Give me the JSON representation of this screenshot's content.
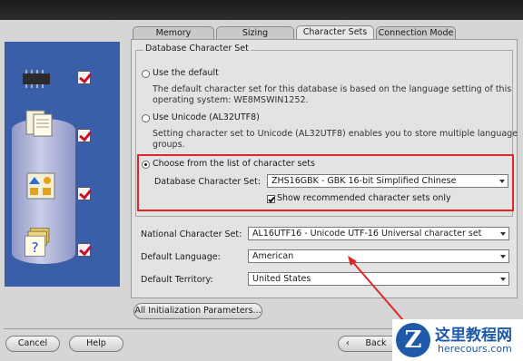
{
  "tabs": [
    {
      "label": "Memory"
    },
    {
      "label": "Sizing"
    },
    {
      "label": "Character Sets",
      "active": true
    },
    {
      "label": "Connection Mode"
    }
  ],
  "group_title": "Database Character Set",
  "options": {
    "default": {
      "label": "Use the default",
      "desc_line1": "The default character set for this database is based on the language setting of this",
      "desc_line2": "operating system: WE8MSWIN1252."
    },
    "unicode": {
      "label": "Use Unicode (AL32UTF8)",
      "desc_line1": "Setting character set to Unicode (AL32UTF8) enables you to store multiple language",
      "desc_line2": "groups."
    },
    "choose": {
      "label": "Choose from the list of character sets",
      "selected": true
    }
  },
  "db_charset": {
    "label": "Database Character Set:",
    "value": "ZHS16GBK - GBK 16-bit Simplified Chinese"
  },
  "show_recommended": {
    "label": "Show recommended character sets only",
    "checked": true
  },
  "national_charset": {
    "label": "National Character Set:",
    "value": "AL16UTF16 - Unicode UTF-16 Universal character set"
  },
  "default_language": {
    "label": "Default Language:",
    "value": "American"
  },
  "default_territory": {
    "label": "Default Territory:",
    "value": "United States"
  },
  "buttons": {
    "init_params": "All Initialization Parameters...",
    "cancel": "Cancel",
    "help": "Help",
    "back": "Back"
  },
  "watermark": {
    "cn": "这里教程网",
    "url": "herecours.com"
  },
  "colors": {
    "highlight_box": "#e0262b",
    "side_panel": "#3a5fa8",
    "check_mark": "#c8102e"
  }
}
